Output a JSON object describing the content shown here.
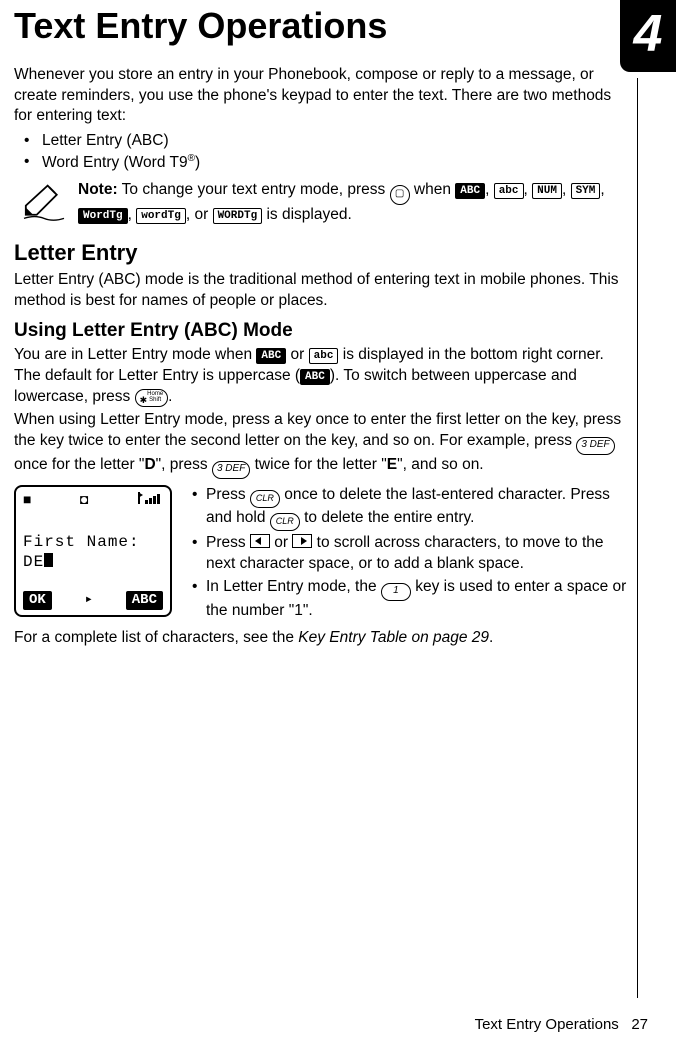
{
  "chapter_number": "4",
  "title": "Text Entry Operations",
  "intro": "Whenever you store an entry in your Phonebook, compose or reply to a message, or create reminders, you use the phone's keypad to enter the text. There are two methods for entering text:",
  "methods": {
    "m1": "Letter Entry (ABC)",
    "m2_prefix": "Word Entry (Word T9",
    "m2_sup": "®",
    "m2_suffix": ")"
  },
  "note": {
    "label": "Note:",
    "part1": " To change your text entry mode, press ",
    "when": " when ",
    "or": " or ",
    "displayed": " is displayed.",
    "modes": {
      "ABC_u": "ABC",
      "abc_l": "abc",
      "NUM": "NUM",
      "SYM": "SYM",
      "WordTg_u": "WordTg",
      "wordTg_l": "wordTg",
      "WORDTg": "WORDTg"
    }
  },
  "letter_entry": {
    "heading": "Letter Entry",
    "desc": "Letter Entry (ABC) mode is the traditional method of entering text in mobile phones. This method is best for names of people or places."
  },
  "using": {
    "heading": "Using Letter Entry (ABC) Mode",
    "p1a": "You are in Letter Entry mode when ",
    "p1b": " or ",
    "p1c": " is displayed in the bottom right corner. The default for Letter Entry is uppercase (",
    "p1d": "). To switch between uppercase and lowercase, press ",
    "p1e": ".",
    "p2a": "When using Letter Entry mode, press a key once to enter the first letter on the key, press the key twice to enter the second letter on the key, and so on. For example, press ",
    "p2b": " once for the letter \"",
    "p2b_letter": "D",
    "p2c": "\", press ",
    "p2d": " twice for the letter \"",
    "p2d_letter": "E",
    "p2e": "\", and so on."
  },
  "keys": {
    "softkey": "▭",
    "star_shift_top": "Home",
    "star_shift_bot": "Shift",
    "three_def": "3 DEF",
    "clr": "CLR",
    "one": "1"
  },
  "screen": {
    "icon_left": "■",
    "icon_mid": "◘",
    "line1": "First Name:",
    "line2": "DE",
    "soft_left": "OK",
    "soft_right": "ABC"
  },
  "side": {
    "b1a": "Press ",
    "b1b": " once to delete the last-entered character. Press and hold ",
    "b1c": " to delete the entire entry.",
    "b2a": "Press ",
    "b2_or": " or ",
    "b2b": " to scroll across characters, to move to the next character space, or to add a blank space.",
    "b3a": "In Letter Entry mode, the ",
    "b3b": " key is used to enter a space or the number \"1\"."
  },
  "closer_a": "For a complete list of characters, see the ",
  "closer_italic": "Key Entry Table on page 29",
  "closer_b": ".",
  "footer": {
    "section": "Text Entry Operations",
    "page": "27"
  }
}
